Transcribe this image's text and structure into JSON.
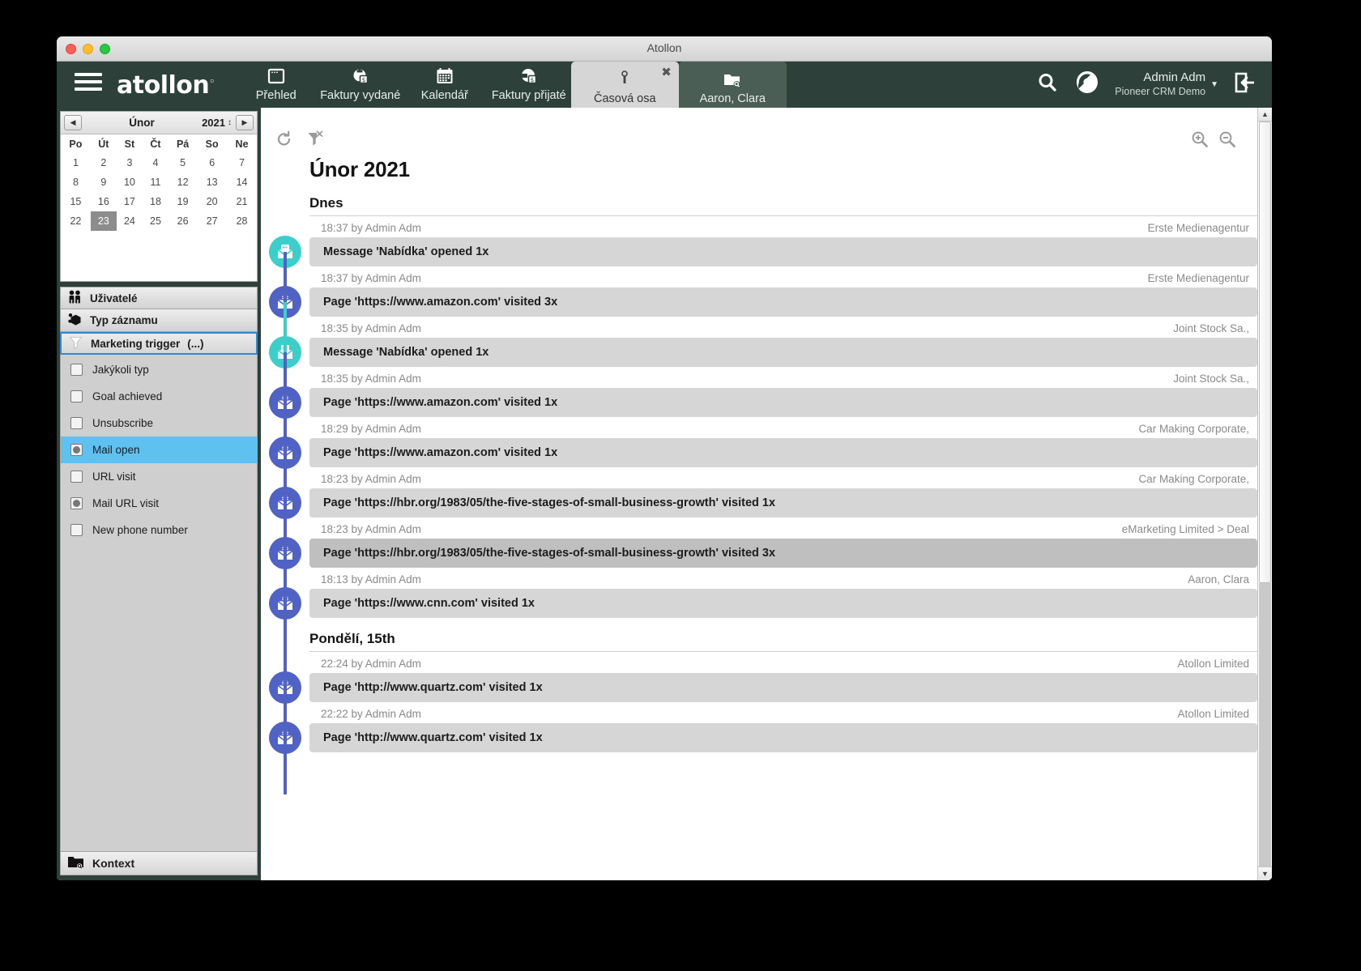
{
  "window": {
    "title": "Atollon"
  },
  "appbar": {
    "logo": "atollon",
    "nav": [
      {
        "label": "Přehled",
        "icon": "window-icon"
      },
      {
        "label": "Faktury vydané",
        "icon": "invoice-out-icon"
      },
      {
        "label": "Kalendář",
        "icon": "calendar-icon"
      },
      {
        "label": "Faktury přijaté",
        "icon": "invoice-in-icon"
      }
    ],
    "tabs": [
      {
        "label": "Časová osa",
        "icon": "timeline-icon",
        "active": true,
        "close": "✖"
      },
      {
        "label": "Aaron, Clara",
        "icon": "folder-search-icon",
        "active": false
      }
    ],
    "search_icon": "search-icon",
    "tools_icon": "wrench-icon",
    "logout_icon": "logout-icon",
    "user": {
      "name": "Admin Adm",
      "org": "Pioneer CRM Demo",
      "caret": "▼"
    }
  },
  "sidebar": {
    "calendar": {
      "prev": "◀",
      "next": "▶",
      "month": "Únor",
      "year": "2021",
      "spinner": "↕",
      "weekdays": [
        "Po",
        "Út",
        "St",
        "Čt",
        "Pá",
        "So",
        "Ne"
      ],
      "weeks": [
        [
          "1",
          "2",
          "3",
          "4",
          "5",
          "6",
          "7"
        ],
        [
          "8",
          "9",
          "10",
          "11",
          "12",
          "13",
          "14"
        ],
        [
          "15",
          "16",
          "17",
          "18",
          "19",
          "20",
          "21"
        ],
        [
          "22",
          "23",
          "24",
          "25",
          "26",
          "27",
          "28"
        ]
      ],
      "selected_day": "23"
    },
    "sections": [
      {
        "label": "Uživatelé",
        "icon": "users-icon",
        "selected": false
      },
      {
        "label": "Typ záznamu",
        "icon": "record-type-icon",
        "selected": false
      },
      {
        "label": "Marketing trigger",
        "suffix": "(...)",
        "icon": "funnel-icon",
        "selected": true
      }
    ],
    "filters": [
      {
        "label": "Jakýkoli typ",
        "state": "unchecked",
        "highlighted": false
      },
      {
        "label": "Goal achieved",
        "state": "unchecked",
        "highlighted": false
      },
      {
        "label": "Unsubscribe",
        "state": "unchecked",
        "highlighted": false
      },
      {
        "label": "Mail open",
        "state": "dot",
        "highlighted": true
      },
      {
        "label": "URL visit",
        "state": "unchecked",
        "highlighted": false
      },
      {
        "label": "Mail URL visit",
        "state": "dot",
        "highlighted": false
      },
      {
        "label": "New phone number",
        "state": "unchecked",
        "highlighted": false
      }
    ],
    "kontext": {
      "label": "Kontext",
      "icon": "folder-search-icon"
    }
  },
  "main": {
    "toolbar": {
      "refresh_icon": "refresh-icon",
      "clear-filter_icon": "clear-filter-icon"
    },
    "zoom": {
      "in_icon": "zoom-in-icon",
      "out_icon": "zoom-out-icon"
    },
    "month_title": "Únor 2021",
    "groups": [
      {
        "day_label": "Dnes",
        "entries": [
          {
            "time": "18:37",
            "by": "by Admin Adm",
            "context": "Erste Medienagentur",
            "text": "Message 'Nabídka' opened 1x",
            "icon": "mail-open-icon",
            "color": "teal",
            "highlighted": false
          },
          {
            "time": "18:37",
            "by": "by Admin Adm",
            "context": "Erste Medienagentur",
            "text": "Page 'https://www.amazon.com' visited 3x",
            "icon": "mail-url-visit-icon",
            "color": "blue",
            "highlighted": false
          },
          {
            "time": "18:35",
            "by": "by Admin Adm",
            "context": "Joint Stock Sa.,",
            "text": "Message 'Nabídka' opened 1x",
            "icon": "mail-open-icon",
            "color": "teal",
            "highlighted": false
          },
          {
            "time": "18:35",
            "by": "by Admin Adm",
            "context": "Joint Stock Sa.,",
            "text": "Page 'https://www.amazon.com' visited 1x",
            "icon": "mail-url-visit-icon",
            "color": "blue",
            "highlighted": false
          },
          {
            "time": "18:29",
            "by": "by Admin Adm",
            "context": "Car Making Corporate,",
            "text": "Page 'https://www.amazon.com' visited 1x",
            "icon": "mail-url-visit-icon",
            "color": "blue",
            "highlighted": false
          },
          {
            "time": "18:23",
            "by": "by Admin Adm",
            "context": "Car Making Corporate,",
            "text": "Page 'https://hbr.org/1983/05/the-five-stages-of-small-business-growth' visited 1x",
            "icon": "mail-url-visit-icon",
            "color": "blue",
            "highlighted": false
          },
          {
            "time": "18:23",
            "by": "by Admin Adm",
            "context": "eMarketing Limited > Deal",
            "text": "Page 'https://hbr.org/1983/05/the-five-stages-of-small-business-growth' visited 3x",
            "icon": "mail-url-visit-icon",
            "color": "blue",
            "highlighted": true
          },
          {
            "time": "18:13",
            "by": "by Admin Adm",
            "context": "Aaron, Clara",
            "text": "Page 'https://www.cnn.com' visited 1x",
            "icon": "mail-url-visit-icon",
            "color": "blue",
            "highlighted": false
          }
        ]
      },
      {
        "day_label": "Pondělí, 15th",
        "entries": [
          {
            "time": "22:24",
            "by": "by Admin Adm",
            "context": "Atollon Limited",
            "text": "Page 'http://www.quartz.com' visited 1x",
            "icon": "mail-url-visit-icon",
            "color": "blue",
            "highlighted": false
          },
          {
            "time": "22:22",
            "by": "by Admin Adm",
            "context": "Atollon Limited",
            "text": "Page 'http://www.quartz.com' visited 1x",
            "icon": "mail-url-visit-icon",
            "color": "blue",
            "highlighted": false
          }
        ]
      }
    ],
    "scrollbar": {
      "up": "▲",
      "down": "▼",
      "thumb_fraction": 0.62
    }
  },
  "colors": {
    "appbar": "#2d4039",
    "tab_active": "#d6d6d6",
    "tab_inactive": "#4a5e56",
    "teal": "#3ccfc9",
    "blue": "#5063c4",
    "highlight": "#5ec1f0",
    "bar": "#d6d6d6",
    "bar_highlight": "#bfbfbf"
  }
}
